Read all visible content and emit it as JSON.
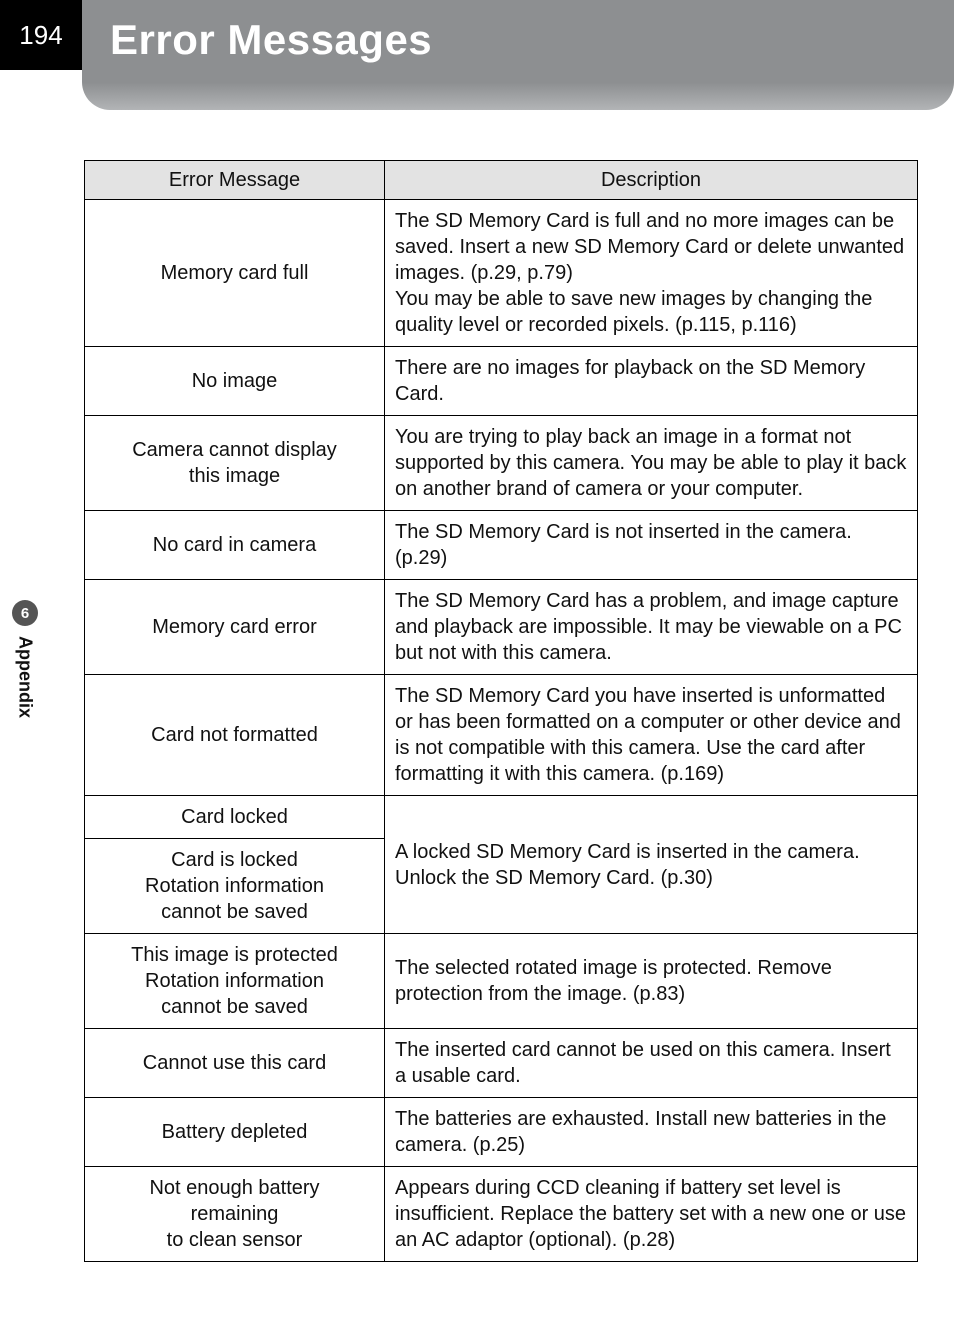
{
  "page_number": "194",
  "title": "Error Messages",
  "sidebar": {
    "section_number": "6",
    "section_label": "Appendix"
  },
  "table": {
    "headers": [
      "Error Message",
      "Description"
    ],
    "rows": [
      {
        "msg": "Memory card full",
        "desc": "The SD Memory Card is full and no more images can be saved. Insert a new SD Memory Card or delete unwanted images. (p.29, p.79)\nYou may be able to save new images by changing the quality level or recorded pixels. (p.115, p.116)"
      },
      {
        "msg": "No image",
        "desc": "There are no images for playback on the SD Memory Card."
      },
      {
        "msg": "Camera cannot display\nthis image",
        "desc": "You are trying to play back an image in a format not supported by this camera. You may be able to play it back on another brand of camera or your computer."
      },
      {
        "msg": "No card in camera",
        "desc": "The SD Memory Card is not inserted in the camera. (p.29)"
      },
      {
        "msg": "Memory card error",
        "desc": "The SD Memory Card has a problem, and image capture and playback are impossible. It may be viewable on a PC but not with this camera."
      },
      {
        "msg": "Card not formatted",
        "desc": "The SD Memory Card you have inserted is unformatted or has been formatted on a computer or other device and is not compatible with this camera. Use the card after formatting it with this camera. (p.169)"
      },
      {
        "msg": "Card locked",
        "desc_merge_top": true,
        "desc": "A locked SD Memory Card is inserted in the camera. Unlock the SD Memory Card. (p.30)"
      },
      {
        "msg": "Card is locked\nRotation information\ncannot be saved",
        "desc_merge_bottom": true
      },
      {
        "msg": "This image is protected\nRotation information\ncannot be saved",
        "desc": "The selected rotated image is protected. Remove protection from the image. (p.83)"
      },
      {
        "msg": "Cannot use this card",
        "desc": "The inserted card cannot be used on this camera. Insert a usable card."
      },
      {
        "msg": "Battery depleted",
        "desc": "The batteries are exhausted. Install new batteries in the camera. (p.25)"
      },
      {
        "msg": "Not enough battery\nremaining\nto clean sensor",
        "desc": "Appears during CCD cleaning if battery set level is insufficient. Replace the battery set with a new one or use an AC adaptor (optional). (p.28)"
      }
    ]
  }
}
